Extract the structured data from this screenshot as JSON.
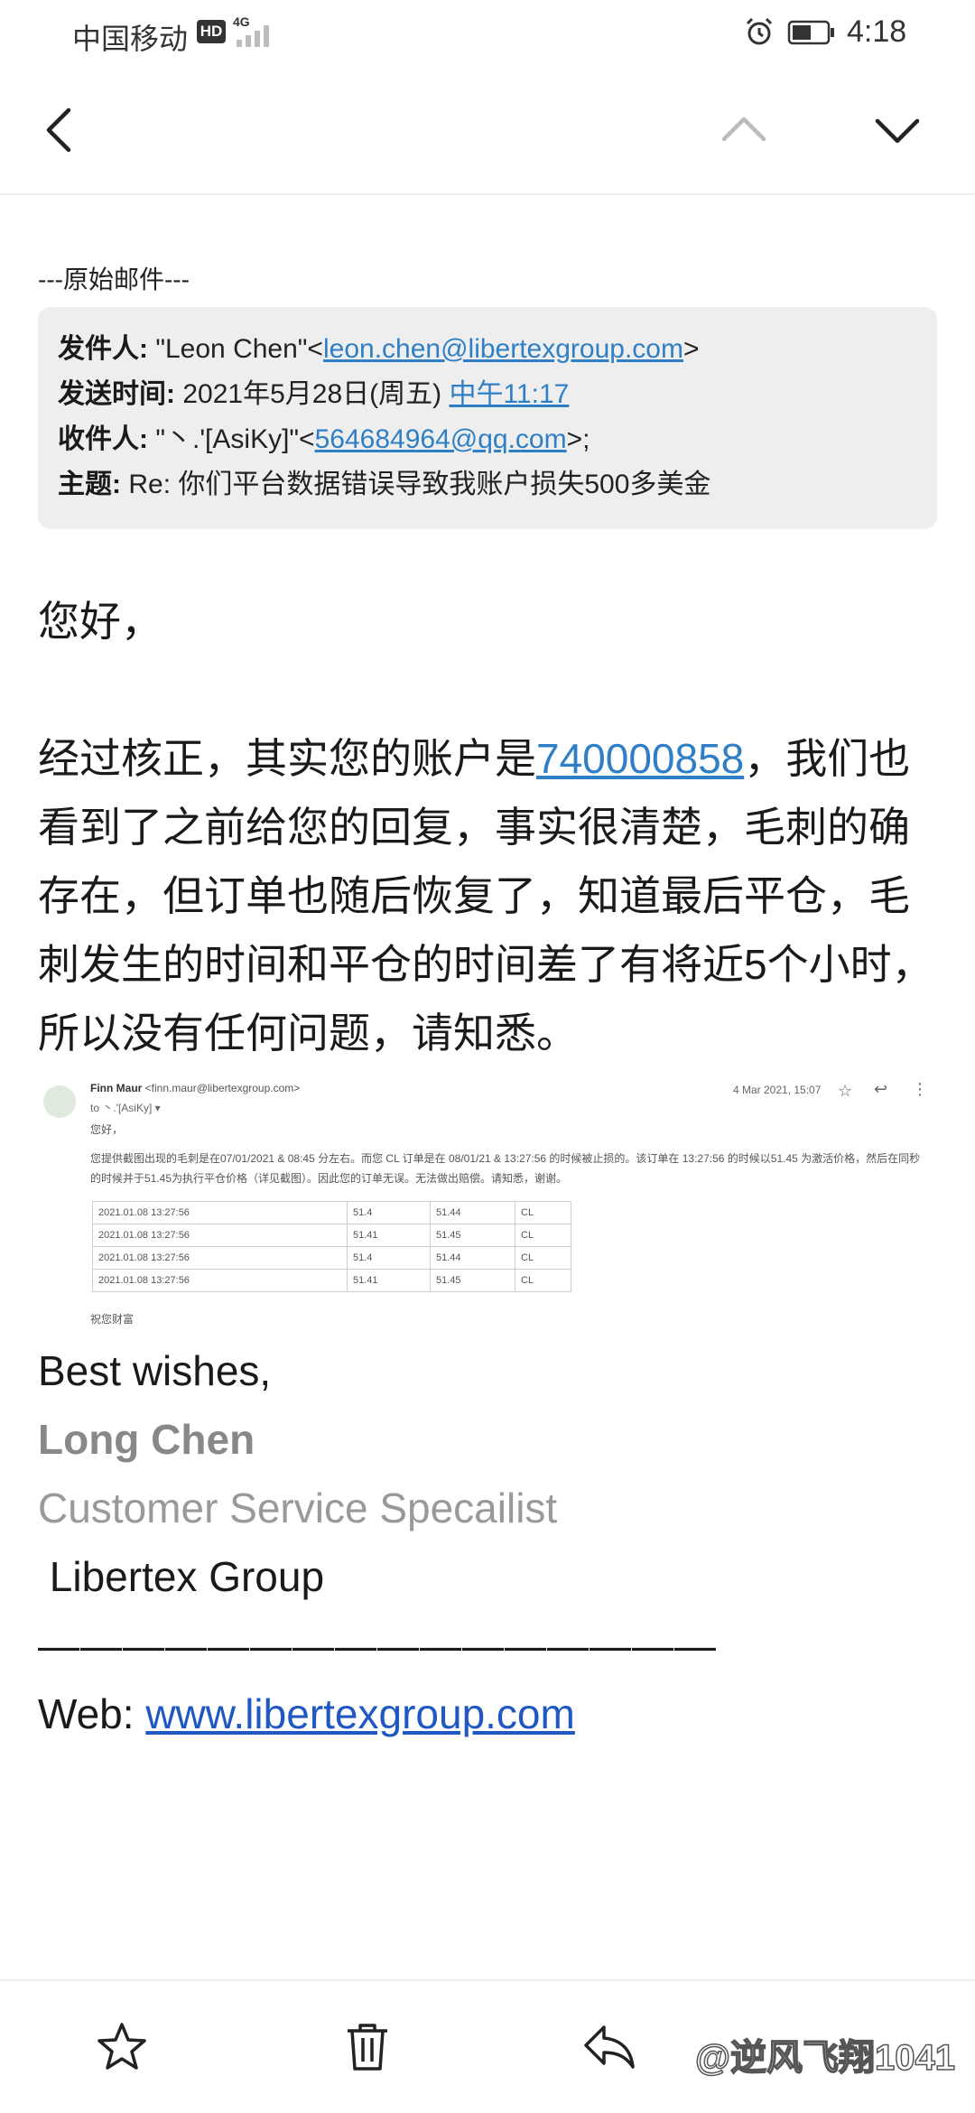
{
  "status_bar": {
    "carrier": "中国移动",
    "hd_badge": "HD",
    "network": "4G",
    "time": "4:18"
  },
  "toolbar": {
    "back_icon": "chevron-left-icon",
    "prev_icon": "chevron-up-icon",
    "next_icon": "chevron-down-icon"
  },
  "email": {
    "original_label": "---原始邮件---",
    "header": {
      "from_label": "发件人:",
      "from_name": "\"Leon Chen\"<",
      "from_email": "leon.chen@libertexgroup.com",
      "from_close": ">",
      "sent_label": "发送时间:",
      "sent_date": "2021年5月28日(周五)",
      "sent_time": "中午11:17",
      "to_label": "收件人:",
      "to_name": "\"丶.'[AsiKy]\"<",
      "to_email": "564684964@qq.com",
      "to_close": ">;",
      "subject_label": "主题:",
      "subject": "Re: 你们平台数据错误导致我账户损失500多美金"
    },
    "greeting": "您好，",
    "body_before_link": "经过核正，其实您的账户是",
    "account_number": "740000858",
    "body_after_link": "，我们也看到了之前给您的回复，事实很清楚，毛刺的确存在，但订单也随后恢复了，知道最后平仓，毛刺发生的时间和平仓的时间差了有将近5个小时，所以没有任何问题，请知悉。",
    "embedded": {
      "sender_name": "Finn Maur",
      "sender_email": "<finn.maur@libertexgroup.com>",
      "to_line": "to 丶.'[AsiKy] ▾",
      "date": "4 Mar 2021, 15:07",
      "hello": "您好，",
      "paragraph": "您提供截图出现的毛刺是在07/01/2021 & 08:45 分左右。而您 CL 订单是在 08/01/21 & 13:27:56 的时候被止损的。该订单在 13:27:56 的时候以51.45 为激活价格，然后在同秒的时候并于51.45为执行平仓价格（详见截图）。因此您的订单无误。无法做出赔偿。请知悉，谢谢。",
      "table": [
        [
          "2021.01.08 13:27:56",
          "51.4",
          "51.44",
          "CL"
        ],
        [
          "2021.01.08 13:27:56",
          "51.41",
          "51.45",
          "CL"
        ],
        [
          "2021.01.08 13:27:56",
          "51.4",
          "51.44",
          "CL"
        ],
        [
          "2021.01.08 13:27:56",
          "51.41",
          "51.45",
          "CL"
        ]
      ],
      "footer": "祝您财富"
    },
    "signature": {
      "wishes": "Best wishes,",
      "name": "Long Chen",
      "title": "Customer Service Specailist",
      "company": " Libertex Group",
      "divider": "————————————————",
      "web_label": "Web: ",
      "web_link": "www.libertexgroup.com"
    }
  },
  "bottom_bar": {
    "star_icon": "star-icon",
    "delete_icon": "trash-icon",
    "reply_icon": "reply-icon",
    "watermark": "@逆风飞翔1041"
  }
}
